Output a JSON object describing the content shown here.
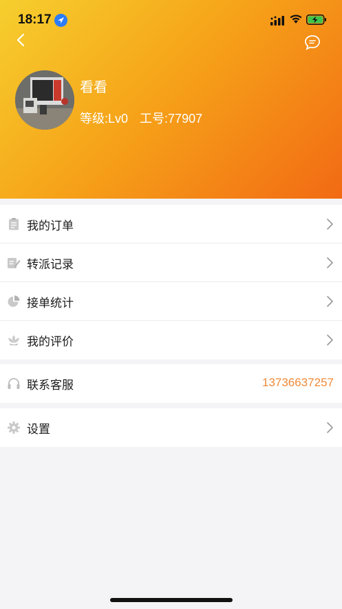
{
  "status_bar": {
    "time": "18:17"
  },
  "header": {
    "back_icon": "chevron-left-icon",
    "message_icon": "chat-bubble-icon"
  },
  "profile": {
    "name": "看看",
    "level": "等级:Lv0",
    "employee_id": "工号:77907"
  },
  "menu_group_1": {
    "items": [
      {
        "label": "我的订单",
        "icon": "clipboard-icon"
      },
      {
        "label": "转派记录",
        "icon": "edit-note-icon"
      },
      {
        "label": "接单统计",
        "icon": "pie-chart-icon"
      },
      {
        "label": "我的评价",
        "icon": "lotus-icon"
      }
    ]
  },
  "contact": {
    "label": "联系客服",
    "phone": "13736637257",
    "icon": "headphones-icon"
  },
  "settings": {
    "label": "设置",
    "icon": "gear-icon"
  },
  "colors": {
    "header_gradient_start": "#f6cf2e",
    "header_gradient_end": "#f26a14",
    "phone_text": "#f08a38",
    "background": "#f4f4f6"
  }
}
